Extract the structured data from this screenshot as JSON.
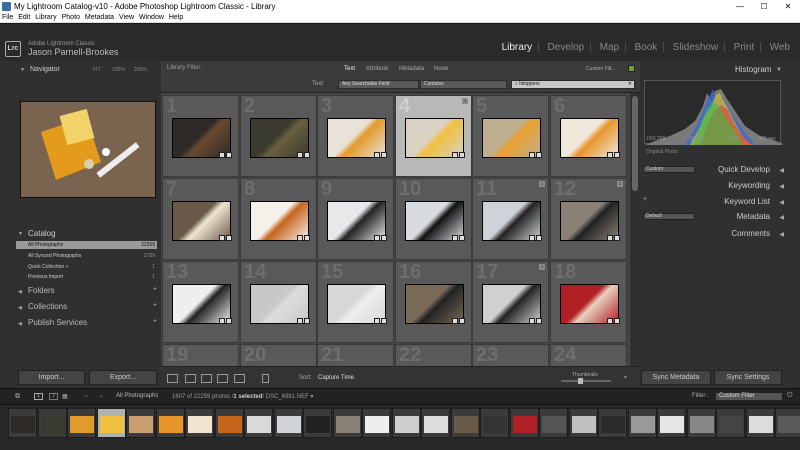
{
  "titlebar": {
    "title": "My Lightroom Catalog-v10 - Adobe Photoshop Lightroom Classic - Library",
    "minimize": "—",
    "maximize": "☐",
    "close": "✕"
  },
  "menu": [
    "File",
    "Edit",
    "Library",
    "Photo",
    "Metadata",
    "View",
    "Window",
    "Help"
  ],
  "identity": {
    "logo": "Lrc",
    "app": "Adobe Lightroom Classic",
    "user": "Jason Parnell-Brookes"
  },
  "modules": [
    "Library",
    "Develop",
    "Map",
    "Book",
    "Slideshow",
    "Print",
    "Web"
  ],
  "active_module": "Library",
  "navigator": {
    "title": "Navigator",
    "zoom": [
      "FIT",
      "100%",
      "200%"
    ]
  },
  "catalog": {
    "title": "Catalog",
    "items": [
      {
        "label": "All Photographs",
        "count": "22259"
      },
      {
        "label": "All Synced Photographs",
        "count": "2739"
      },
      {
        "label": "Quick Collection +",
        "count": "1"
      },
      {
        "label": "Previous Import",
        "count": "1"
      }
    ]
  },
  "sections": [
    "Folders",
    "Collections",
    "Publish Services"
  ],
  "import_label": "Import...",
  "export_label": "Export...",
  "filter": {
    "title": "Library Filter :",
    "tabs": [
      "Text",
      "Attribute",
      "Metadata",
      "None"
    ],
    "custom": "Custom Filt...",
    "text_label": "Text",
    "field": "Any Searchable Field",
    "rule": "Contains",
    "query": "hitoppers"
  },
  "grid": {
    "numbers": [
      "1",
      "2",
      "3",
      "4",
      "5",
      "6",
      "7",
      "8",
      "9",
      "10",
      "11",
      "12",
      "13",
      "14",
      "15",
      "16",
      "17",
      "18",
      "19",
      "20",
      "21",
      "22",
      "23",
      "24"
    ],
    "selected_index": 3
  },
  "toolbar": {
    "sort_label": "Sort:",
    "sort_value": "Capture Time",
    "thumbs_label": "Thumbnails"
  },
  "right": {
    "histogram": "Histogram",
    "iso": "ISO 200",
    "focal": "50 mm",
    "aperture": "f / 8.3",
    "shutter": "1/60 sec",
    "original": "Original Photo",
    "quick_develop": "Quick Develop",
    "keywording": "Keywording",
    "keyword_list": "Keyword List",
    "metadata": "Metadata",
    "comments": "Comments",
    "custom_preset": "Custom",
    "default_preset": "Default",
    "sync_metadata": "Sync Metadata",
    "sync_settings": "Sync Settings"
  },
  "filmbar": {
    "source": "All Photographs",
    "count_text": "1607 of 22259 photos /",
    "selected_text": "1 selected",
    "file": "/ DSC_6981.NEF",
    "filter_label": "Filter :",
    "filter_value": "Custom Filter",
    "page1": "1",
    "page2": "2"
  },
  "colors": {
    "accent": "#eeeeee",
    "panel": "#303030",
    "grid": "#454545"
  }
}
